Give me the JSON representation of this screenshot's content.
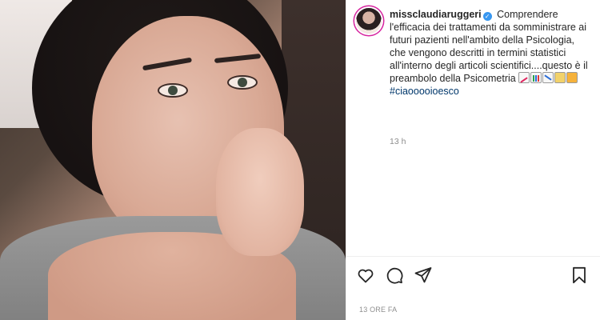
{
  "post": {
    "username": "missclaudiaruggeri",
    "caption_text": "Comprendere l'efficacia dei trattamenti da somministrare ai futuri pazienti nell'ambito della Psicologia, che vengono descritti in termini statistici all'interno degli articoli scientifici....questo è il preambolo della Psicometria",
    "hashtag": "#ciaooooioesco",
    "relative_time": "13 h",
    "date_label": "13 ORE FA"
  },
  "icons": {
    "verified": "verified-badge-icon",
    "like": "heart-icon",
    "comment": "comment-bubble-icon",
    "share": "paper-plane-icon",
    "save": "bookmark-icon",
    "emojis": [
      "chart-increasing-emoji",
      "bar-chart-emoji",
      "chart-decreasing-emoji",
      "ledger-emoji",
      "notebook-emoji"
    ]
  },
  "colors": {
    "text": "#262626",
    "muted": "#8e8e8e",
    "hashtag": "#00376b",
    "verified": "#3897f0"
  }
}
